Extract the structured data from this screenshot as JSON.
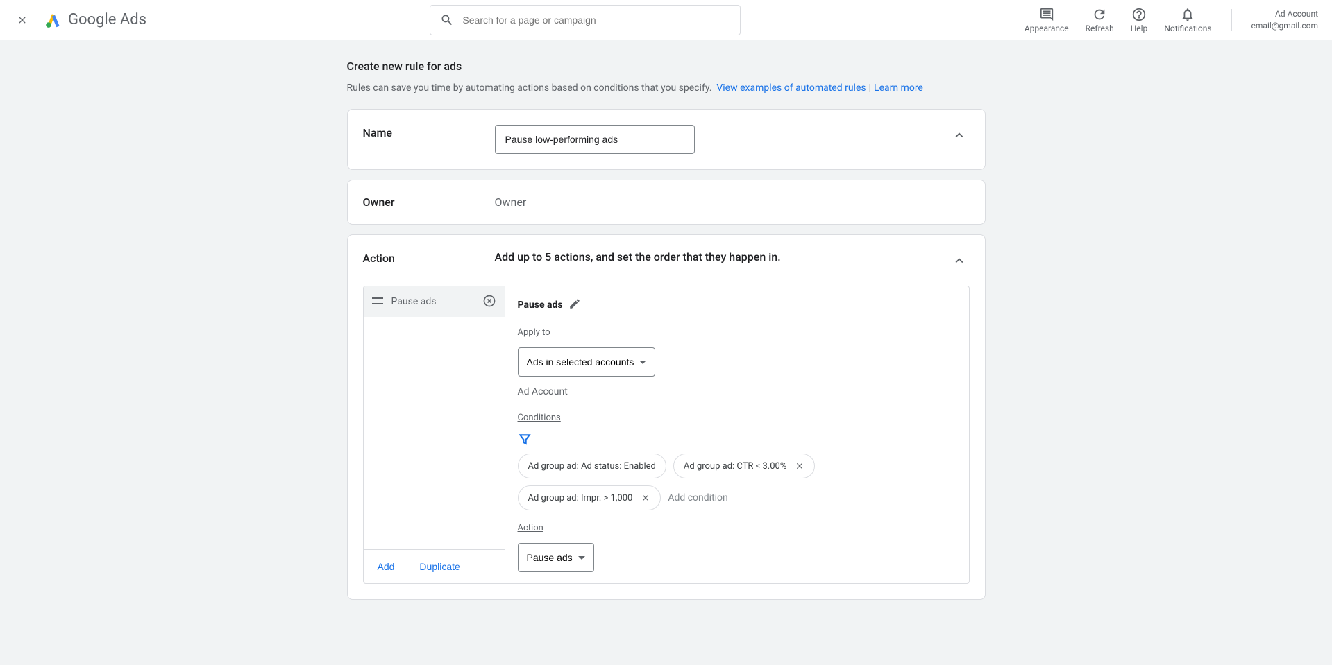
{
  "header": {
    "brand": "Google Ads",
    "search_placeholder": "Search for a page or campaign",
    "actions": {
      "appearance": "Appearance",
      "refresh": "Refresh",
      "help": "Help",
      "notifications": "Notifications"
    },
    "account": {
      "name": "Ad Account",
      "email": "email@gmail.com"
    }
  },
  "page": {
    "title": "Create new rule for ads",
    "subtitle": "Rules can save you time by automating actions based on conditions that you specify.",
    "link_examples": "View examples of automated rules",
    "link_learn": "Learn more"
  },
  "name_section": {
    "label": "Name",
    "value": "Pause low-performing ads"
  },
  "owner_section": {
    "label": "Owner",
    "value": "Owner"
  },
  "action_section": {
    "label": "Action",
    "description": "Add up to 5 actions, and set the order that they happen in.",
    "list": {
      "items": [
        {
          "label": "Pause ads"
        }
      ],
      "add": "Add",
      "duplicate": "Duplicate"
    },
    "detail": {
      "title": "Pause ads",
      "apply_to_label": "Apply to",
      "apply_to_value": "Ads in selected accounts",
      "account_text": "Ad Account",
      "conditions_label": "Conditions",
      "chips": [
        {
          "text": "Ad group ad: Ad status: Enabled",
          "removable": false
        },
        {
          "text": "Ad group ad: CTR < 3.00%",
          "removable": true
        },
        {
          "text": "Ad group ad: Impr. > 1,000",
          "removable": true
        }
      ],
      "add_condition": "Add condition",
      "action_label": "Action",
      "action_value": "Pause ads"
    }
  }
}
